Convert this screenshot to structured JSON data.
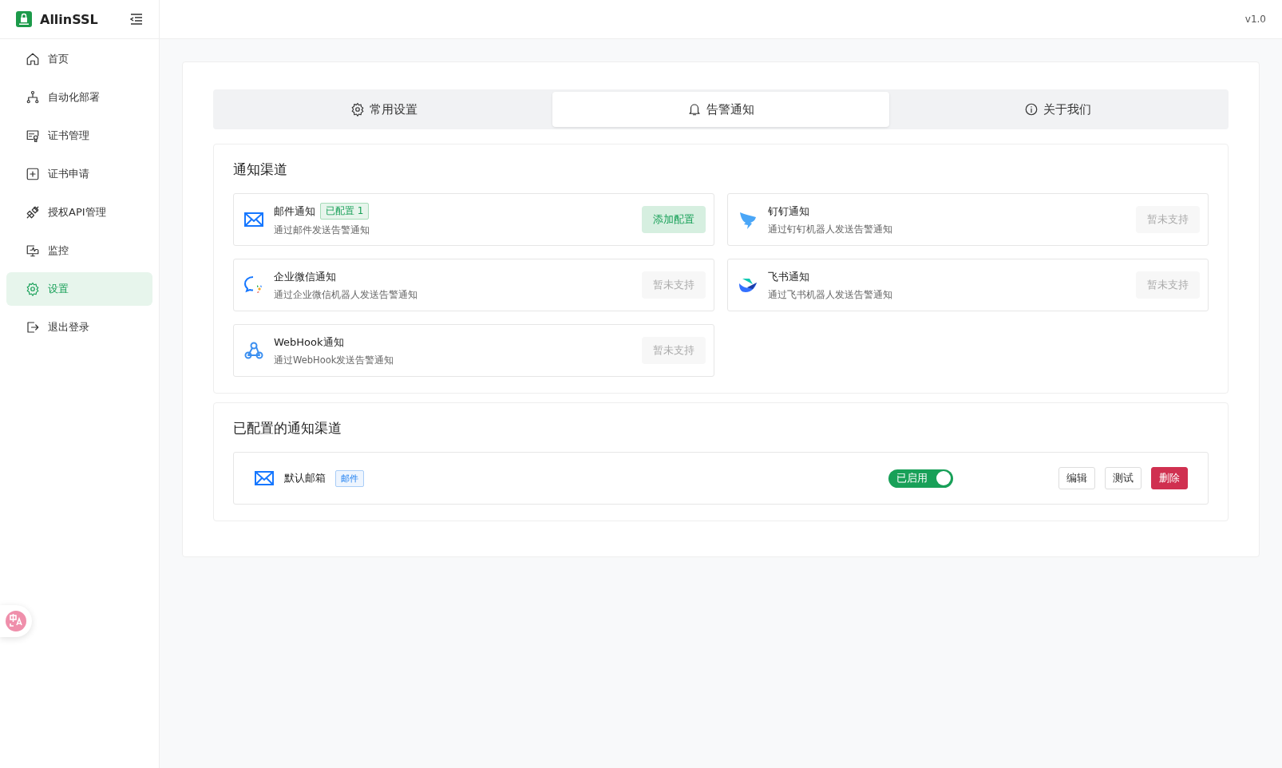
{
  "app": {
    "name": "AllinSSL",
    "version": "v1.0"
  },
  "sidebar": {
    "items": [
      {
        "label": "首页",
        "kind": "home",
        "selected": false
      },
      {
        "label": "自动化部署",
        "kind": "flow",
        "selected": false
      },
      {
        "label": "证书管理",
        "kind": "cert",
        "selected": false
      },
      {
        "label": "证书申请",
        "kind": "plus",
        "selected": false
      },
      {
        "label": "授权API管理",
        "kind": "plug",
        "selected": false
      },
      {
        "label": "监控",
        "kind": "monitor",
        "selected": false
      },
      {
        "label": "设置",
        "kind": "gear",
        "selected": true
      },
      {
        "label": "退出登录",
        "kind": "logout",
        "selected": false
      }
    ]
  },
  "tabs": [
    {
      "label": "常用设置",
      "kind": "gear",
      "selected": false
    },
    {
      "label": "告警通知",
      "kind": "bell",
      "selected": true
    },
    {
      "label": "关于我们",
      "kind": "info",
      "selected": false
    }
  ],
  "channels_section": {
    "title": "通知渠道",
    "channels": [
      {
        "name": "邮件通知",
        "kind": "mail",
        "badge": "已配置 1",
        "description": "通过邮件发送告警通知",
        "button": "添加配置",
        "disabled": false
      },
      {
        "name": "钉钉通知",
        "kind": "dingtalk",
        "description": "通过钉钉机器人发送告警通知",
        "button": "暂未支持",
        "disabled": true
      },
      {
        "name": "企业微信通知",
        "kind": "wecom",
        "description": "通过企业微信机器人发送告警通知",
        "button": "暂未支持",
        "disabled": true
      },
      {
        "name": "飞书通知",
        "kind": "feishu",
        "description": "通过飞书机器人发送告警通知",
        "button": "暂未支持",
        "disabled": true
      },
      {
        "name": "WebHook通知",
        "kind": "webhook",
        "description": "通过WebHook发送告警通知",
        "button": "暂未支持",
        "disabled": true
      }
    ]
  },
  "configured_section": {
    "title": "已配置的通知渠道",
    "items": [
      {
        "name": "默认邮箱",
        "kind": "mail",
        "tag": "邮件",
        "status": "已启用",
        "on": true,
        "actions": [
          "编辑",
          "测试",
          "删除"
        ]
      }
    ]
  }
}
